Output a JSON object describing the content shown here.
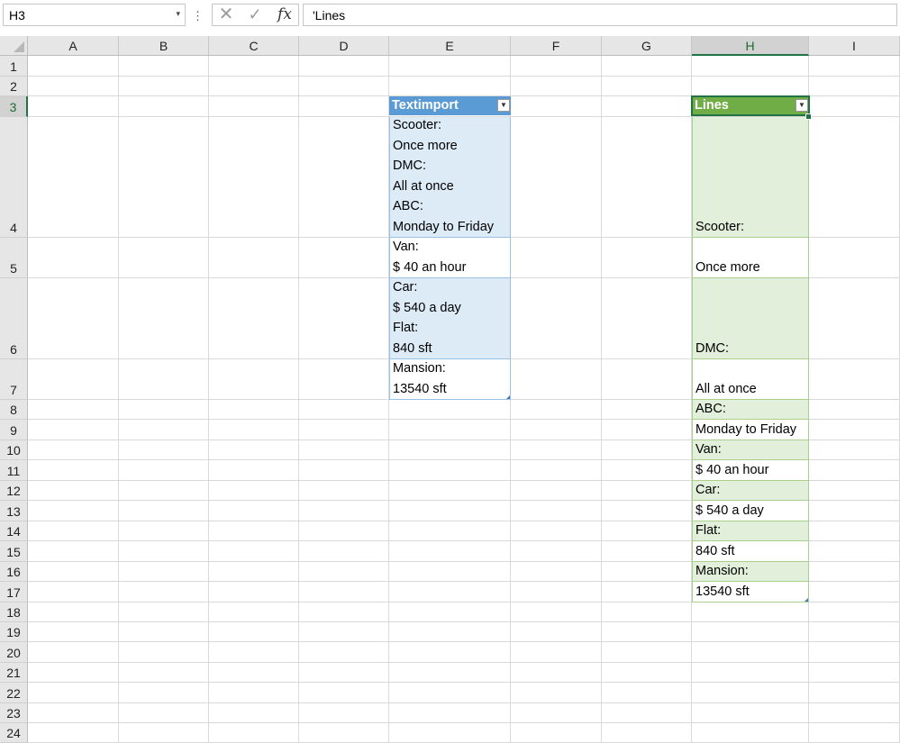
{
  "formula_bar": {
    "name_box": "H3",
    "dropdown_icon": "▾",
    "separator": "⋮",
    "cancel_icon": "✕",
    "enter_icon": "✓",
    "fx_icon": "fx",
    "formula": "'Lines"
  },
  "grid": {
    "columns": [
      "A",
      "B",
      "C",
      "D",
      "E",
      "F",
      "G",
      "H",
      "I"
    ],
    "selected_column": "H",
    "rows": [
      "1",
      "2",
      "3",
      "4",
      "5",
      "6",
      "7",
      "8",
      "9",
      "10",
      "11",
      "12",
      "13",
      "14",
      "15",
      "16",
      "17",
      "18",
      "19",
      "20",
      "21",
      "22",
      "23",
      "24"
    ],
    "selected_row": "3"
  },
  "table_textimport": {
    "header": "Textimport",
    "header_color": "#5b9bd5",
    "band_color": "#ddebf7",
    "cells": [
      "Scooter:\nOnce more\nDMC:\nAll at once\nABC:\nMonday to Friday",
      "Van:\n$ 40 an hour",
      "Car:\n$ 540 a day\nFlat:\n840 sft",
      "Mansion:\n13540 sft"
    ]
  },
  "table_lines": {
    "header": "Lines",
    "header_color": "#70ad47",
    "band_color": "#e2efda",
    "cells": [
      "Scooter:",
      "Once more",
      "DMC:",
      "All at once",
      "ABC:",
      "Monday to Friday",
      "Van:",
      "$ 40 an hour",
      "Car:",
      "$ 540 a day",
      "Flat:",
      "840 sft",
      "Mansion:",
      "13540 sft"
    ]
  }
}
